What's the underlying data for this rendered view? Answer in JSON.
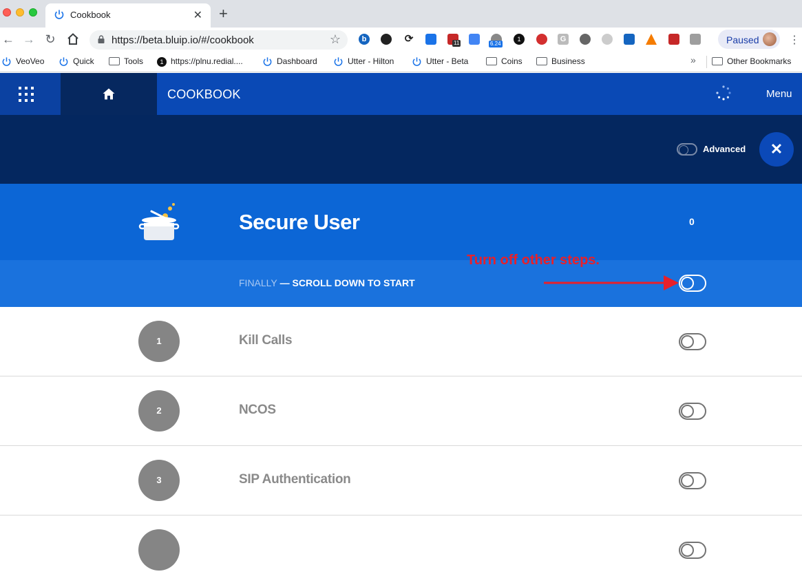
{
  "browser": {
    "tab": {
      "title": "Cookbook"
    },
    "url": "https://beta.bluip.io/#/cookbook",
    "profile_label": "Paused",
    "extension_badges": {
      "calendar": "11",
      "speed": "6.24",
      "one": "1"
    },
    "bookmarks": [
      {
        "label": "VeoVeo",
        "icon": "power-icon"
      },
      {
        "label": "Quick",
        "icon": "power-icon"
      },
      {
        "label": "Tools",
        "icon": "folder-icon"
      },
      {
        "label": "https://plnu.redial....",
        "icon": "one-icon"
      },
      {
        "label": "Dashboard",
        "icon": "power-icon"
      },
      {
        "label": "Utter - Hilton",
        "icon": "power-icon"
      },
      {
        "label": "Utter - Beta",
        "icon": "power-icon"
      },
      {
        "label": "Coins",
        "icon": "folder-icon"
      },
      {
        "label": "Business",
        "icon": "folder-icon"
      }
    ],
    "bookmarks_more": "»",
    "other_bookmarks": "Other Bookmarks"
  },
  "app": {
    "title": "COOKBOOK",
    "menu_label": "Menu",
    "advanced_label": "Advanced",
    "close_symbol": "✕",
    "recipe": {
      "title": "Secure User",
      "count": "0"
    },
    "finally": {
      "prefix": "FINALLY",
      "text": " — SCROLL DOWN TO START"
    },
    "annotation": "Turn off other steps.",
    "steps": [
      {
        "number": "1",
        "name": "Kill Calls"
      },
      {
        "number": "2",
        "name": "NCOS"
      },
      {
        "number": "3",
        "name": "SIP Authentication"
      }
    ]
  },
  "colors": {
    "header_blue": "#0a49b5",
    "dark_navy": "#04275f",
    "recipe_blue": "#0c66d6",
    "finally_blue": "#1a72dd",
    "annotation_red": "#e8202a",
    "step_grey": "#858585"
  }
}
